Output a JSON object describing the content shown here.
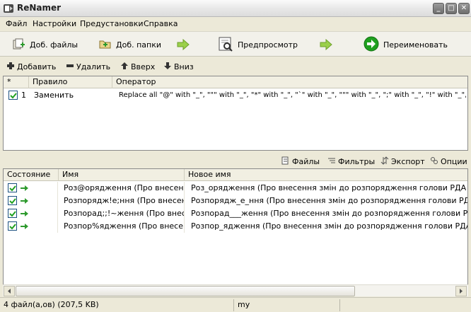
{
  "window": {
    "title": "ReNamer",
    "minimize": "_",
    "maximize": "□",
    "close": "✕"
  },
  "menu": [
    "Файл",
    "Настройки",
    "Предустановки",
    "Справка"
  ],
  "toolbar": {
    "add_files": "Доб. файлы",
    "add_folders": "Доб. папки",
    "preview": "Предпросмотр",
    "rename": "Переименовать"
  },
  "rules_toolbar": {
    "add": "Добавить",
    "remove": "Удалить",
    "up": "Вверх",
    "down": "Вниз"
  },
  "rules_table": {
    "columns": [
      "*",
      "Правило",
      "Оператор"
    ],
    "rows": [
      {
        "index": "1",
        "rule": "Заменить",
        "operator": "Replace all \"@\" with \"_\", \"\"\" with \"_\", \"*\" with \"_\", \"`\" with \"_\", \"\"\" with \"_\", \";\" with \"_\", \"!\" with \"_\", \"\"\" ..."
      }
    ]
  },
  "files_toolbar": {
    "files": "Файлы",
    "filters": "Фильтры",
    "export": "Экспорт",
    "options": "Опции"
  },
  "files_table": {
    "columns": [
      "Состояние",
      "Имя",
      "Новое имя"
    ],
    "rows": [
      {
        "name": "Роз@орядження (Про внесенн...",
        "new_name": "Роз_орядження (Про внесення змін до розпорядження голови РДА Лан-Агр"
      },
      {
        "name": "Розпорядж!е;ння (Про внесенн...",
        "new_name": "Розпорядж_е_ння (Про внесення змін до розпорядження голови РДА Овсеп"
      },
      {
        "name": "Розпорад;;!~ження (Про внесе...",
        "new_name": "Розпорад___ження (Про внесення змін до розпорядження голови РДА Войт"
      },
      {
        "name": "Розпор%ядження (Про внесенн...",
        "new_name": "Розпор_ядження (Про внесення змін до розпорядження голови РДА Кузьміч"
      }
    ]
  },
  "status": {
    "count": "4 файл(а,ов) (207,5 KB)",
    "user": "my"
  },
  "colors": {
    "accent_green": "#2e9a2e",
    "rename_green": "#1fa01f",
    "checkbox_border": "#1c5180"
  }
}
